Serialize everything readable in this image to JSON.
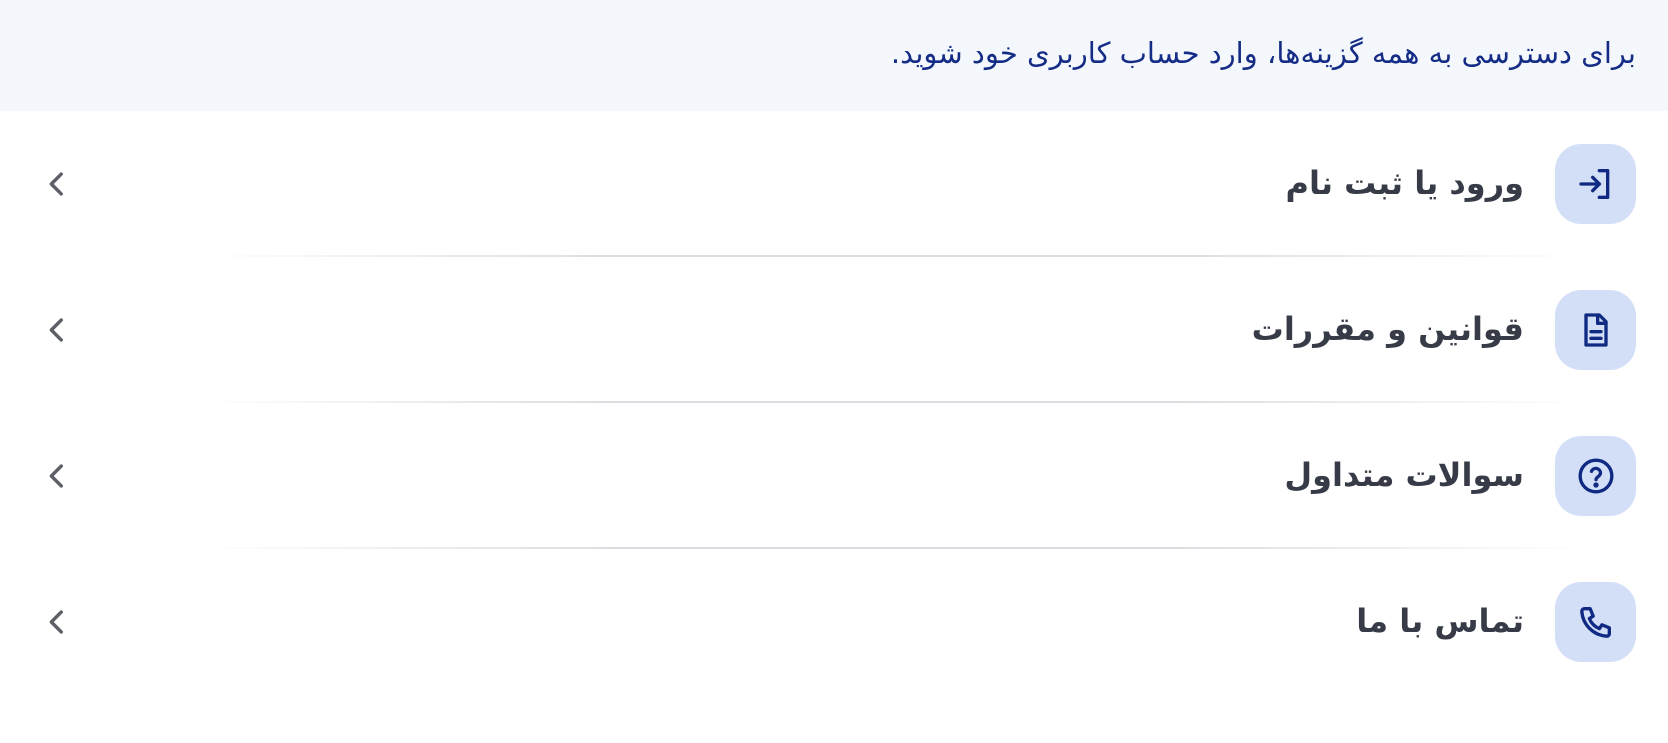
{
  "banner": {
    "text": "برای دسترسی به همه گزینه‌ها، وارد حساب کاربری خود شوید."
  },
  "menu": {
    "items": [
      {
        "label": "ورود یا ثبت نام",
        "icon": "login-icon"
      },
      {
        "label": "قوانین و مقررات",
        "icon": "document-icon"
      },
      {
        "label": "سوالات متداول",
        "icon": "question-circle-icon"
      },
      {
        "label": "تماس با ما",
        "icon": "phone-icon"
      }
    ],
    "chevron_icon": "chevron-left-icon"
  },
  "colors": {
    "banner_background": "#f4f8fc",
    "banner_text": "#142c86",
    "icon_background": "#d3dff7",
    "icon_stroke": "#102a83",
    "label_text": "#363b47",
    "chevron": "#5c5f66"
  }
}
